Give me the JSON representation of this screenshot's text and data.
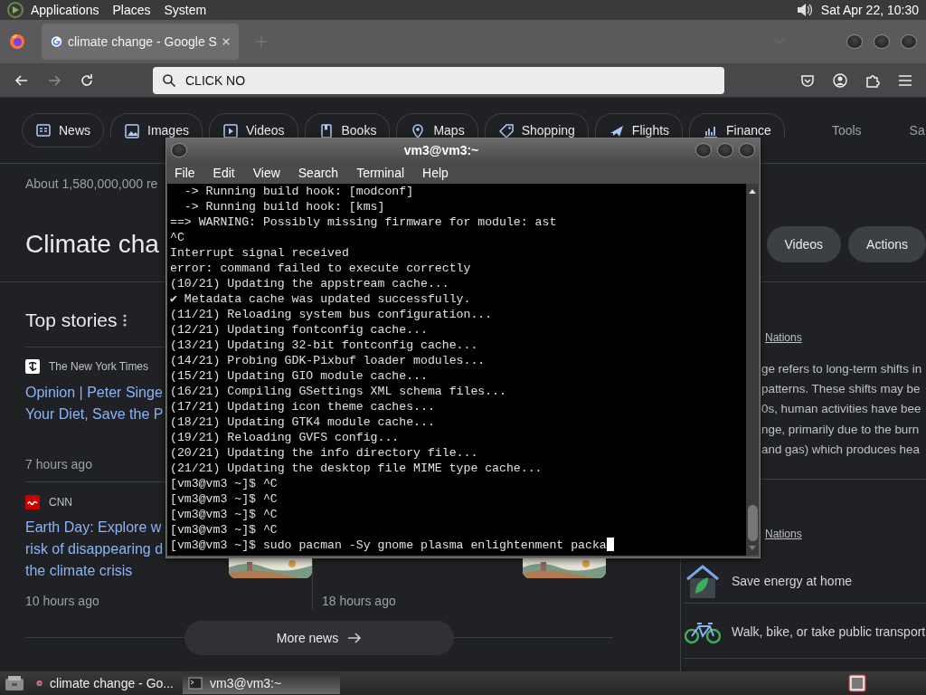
{
  "top_panel": {
    "menu": [
      "Applications",
      "Places",
      "System"
    ],
    "clock": "Sat Apr 22, 10:30"
  },
  "browser": {
    "tabs": [
      {
        "title": "climate change - Google S",
        "selected": true
      }
    ],
    "nav_buttons": [
      {
        "kind": "back",
        "disabled": false
      },
      {
        "kind": "forward",
        "disabled": true
      },
      {
        "kind": "reload",
        "disabled": false
      }
    ],
    "address": {
      "value": "CLICK NO"
    },
    "page": {
      "filters": [
        {
          "label": "News",
          "kind": "news"
        },
        {
          "label": "Images",
          "kind": "images"
        },
        {
          "label": "Videos",
          "kind": "videos"
        },
        {
          "label": "Books",
          "kind": "books"
        },
        {
          "label": "Maps",
          "kind": "maps"
        },
        {
          "label": "Shopping",
          "kind": "shopping"
        },
        {
          "label": "Flights",
          "kind": "flights"
        },
        {
          "label": "Finance",
          "kind": "finance"
        }
      ],
      "tools": "Tools",
      "filter_cut": "Sa",
      "result_count": "About 1,580,000,000 re",
      "heading": "Climate cha",
      "heading_chips": [
        "Videos",
        "Actions"
      ],
      "top_stories": {
        "title": "Top stories",
        "stories": [
          {
            "source": "The New York Times",
            "kind": "nyt",
            "title": "Opinion | Peter Singe\nYour Diet, Save the P",
            "time": "7 hours ago",
            "thumbnail": false
          },
          {
            "source": "CNN",
            "kind": "cnn",
            "title": "Earth Day: Explore w\nrisk of disappearing d\nthe climate crisis",
            "time": "10 hours ago",
            "thumbnail": true
          },
          {
            "time": "18 hours ago",
            "thumbnail": true
          }
        ]
      },
      "more_news": "More news",
      "panel": {
        "sources": [
          {
            "link": "Nations",
            "description": "ge refers to long-term shifts in\npatterns. These shifts may be\n0s, human activities have bee\nnge, primarily due to the burn\nand gas) which produces hea"
          },
          {
            "link": "Nations"
          }
        ],
        "tips": [
          {
            "label": "Save energy at home",
            "kind": "home"
          },
          {
            "label": "Walk, bike, or take public transport",
            "kind": "bike"
          }
        ]
      }
    }
  },
  "terminal": {
    "title": "vm3@vm3:~",
    "menu": [
      "File",
      "Edit",
      "View",
      "Search",
      "Terminal",
      "Help"
    ],
    "lines": [
      "  -> Running build hook: [modconf]",
      "  -> Running build hook: [kms]",
      "==> WARNING: Possibly missing firmware for module: ast",
      "^C",
      "Interrupt signal received",
      "error: command failed to execute correctly",
      "(10/21) Updating the appstream cache...",
      "✔ Metadata cache was updated successfully.",
      "(11/21) Reloading system bus configuration...",
      "(12/21) Updating fontconfig cache...",
      "(13/21) Updating 32-bit fontconfig cache...",
      "(14/21) Probing GDK-Pixbuf loader modules...",
      "(15/21) Updating GIO module cache...",
      "(16/21) Compiling GSettings XML schema files...",
      "(17/21) Updating icon theme caches...",
      "(18/21) Updating GTK4 module cache...",
      "(19/21) Reloading GVFS config...",
      "(20/21) Updating the info directory file...",
      "(21/21) Updating the desktop file MIME type cache...",
      "[vm3@vm3 ~]$ ^C",
      "[vm3@vm3 ~]$ ^C",
      "[vm3@vm3 ~]$ ^C",
      "[vm3@vm3 ~]$ ^C",
      "[vm3@vm3 ~]$ sudo pacman -Sy gnome plasma enlightenment packa"
    ]
  },
  "taskbar": {
    "tasks": [
      {
        "label": "climate change - Go...",
        "kind": "browser",
        "selected": false
      },
      {
        "label": "vm3@vm3:~",
        "kind": "terminal",
        "selected": true
      }
    ]
  }
}
